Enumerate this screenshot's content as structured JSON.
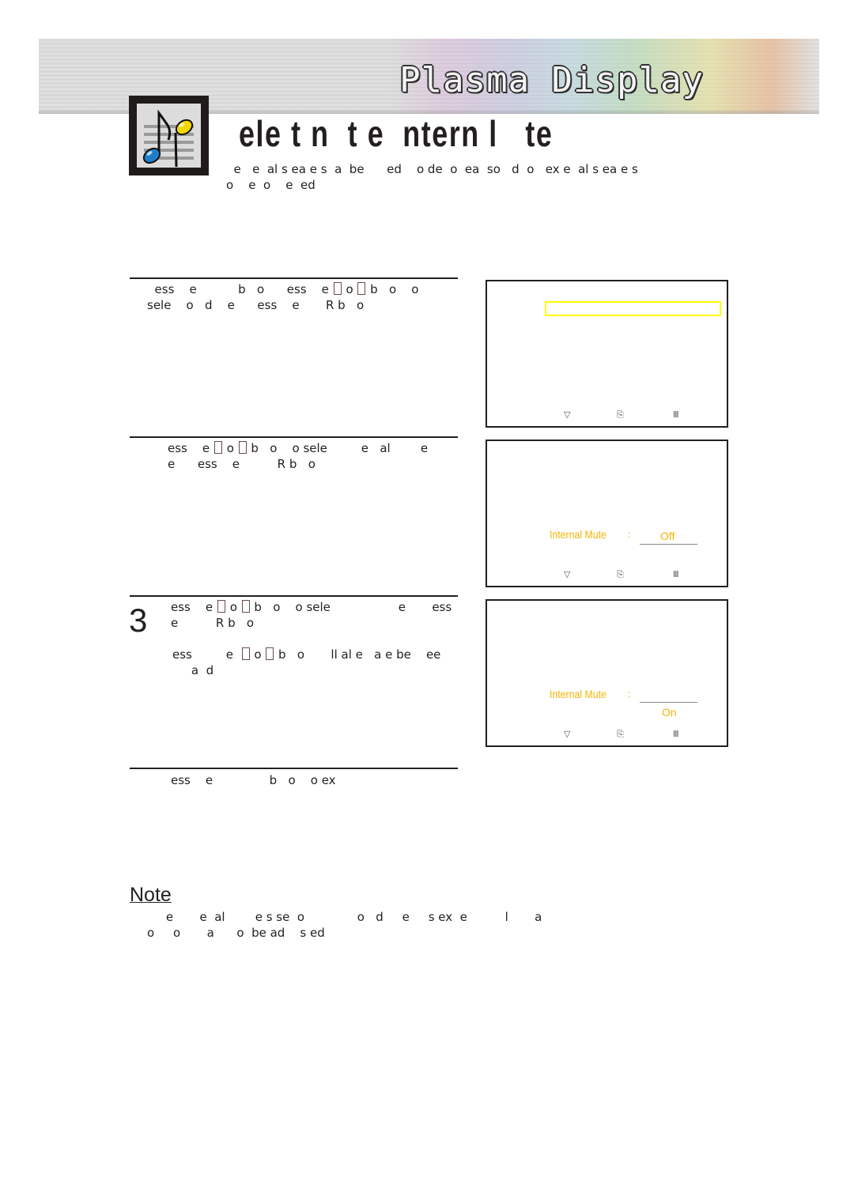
{
  "banner": {
    "title": "Plasma Display"
  },
  "header": {
    "icon": "music-note-icon",
    "title": "ele t n  t e  ntern l   te",
    "intro_line1": "  e   e  al s ea e s  a  be      ed    o de  o  ea  so   d  o   ex e  al s ea e s",
    "intro_line2": "o    e  o    e  ed"
  },
  "steps": [
    {
      "number": "",
      "line1a": "  ess    e           b   o      ess    e ",
      "line1b": " o ",
      "line1c": " b   o    o",
      "line2": "sele    o   d    e      ess    e       R b   o"
    },
    {
      "number": "",
      "line1a": "ess    e ",
      "line1b": " o ",
      "line1c": " b   o    o sele         e   al        e",
      "line2": "e      ess    e          R b   o"
    },
    {
      "number": "3",
      "line1a": "ess    e ",
      "line1b": " o ",
      "line1c": " b   o    o sele                  e       ess",
      "line2": "e          R b   o",
      "sub_line1a": "ess         e  ",
      "sub_line1b": " o ",
      "sub_line1c": " b   o       ll al e   a e be    ee",
      "sub_line2": "     a  d"
    },
    {
      "number": "",
      "line1": "ess    e               b   o    o ex"
    }
  ],
  "screens": [
    {
      "highlight_color": "#ffff00",
      "hints": [
        "move-icon",
        "enter-icon",
        "menu-icon"
      ]
    },
    {
      "label": "Internal Mute",
      "colon": ":",
      "value": "Off",
      "hints": [
        "move-icon",
        "enter-icon",
        "menu-icon"
      ]
    },
    {
      "label": "Internal Mute",
      "colon": ":",
      "value": "On",
      "hints": [
        "move-icon",
        "enter-icon",
        "menu-icon"
      ]
    }
  ],
  "hint_glyphs": {
    "move": "▽",
    "enter": "⎘",
    "menu": "Ⅲ"
  },
  "note": {
    "title": "Note",
    "line1": "     e       e  al        e s se  o              o   d     e     s ex  e          l       a",
    "line2": "o     o       a      o  be ad    s ed"
  },
  "colors": {
    "osd_text": "#f5b400",
    "highlight": "#ffff00",
    "text": "#231f20"
  }
}
